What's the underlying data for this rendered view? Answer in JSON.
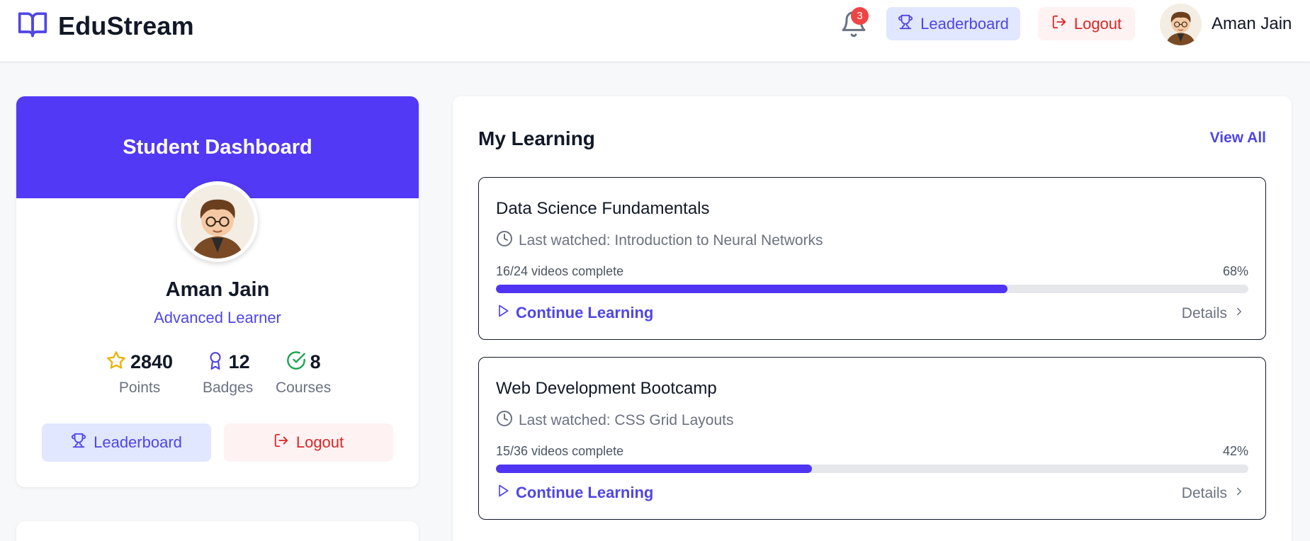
{
  "header": {
    "brand": "EduStream",
    "notification_count": "3",
    "leaderboard_label": "Leaderboard",
    "logout_label": "Logout",
    "user_name": "Aman Jain"
  },
  "profile": {
    "heading": "Student Dashboard",
    "name": "Aman Jain",
    "level": "Advanced Learner",
    "stats": [
      {
        "value": "2840",
        "label": "Points",
        "icon": "star-icon"
      },
      {
        "value": "12",
        "label": "Badges",
        "icon": "award-icon"
      },
      {
        "value": "8",
        "label": "Courses",
        "icon": "check-circle-icon"
      }
    ],
    "leaderboard_label": "Leaderboard",
    "logout_label": "Logout"
  },
  "learning": {
    "title": "My Learning",
    "view_all": "View All",
    "courses": [
      {
        "title": "Data Science Fundamentals",
        "last_watched": "Last watched: Introduction to Neural Networks",
        "progress_text": "16/24 videos complete",
        "percent_label": "68%",
        "progress": 0.68,
        "continue_label": "Continue Learning",
        "details_label": "Details"
      },
      {
        "title": "Web Development Bootcamp",
        "last_watched": "Last watched: CSS Grid Layouts",
        "progress_text": "15/36 videos complete",
        "percent_label": "42%",
        "progress": 0.42,
        "continue_label": "Continue Learning",
        "details_label": "Details"
      }
    ]
  },
  "colors": {
    "accent": "#4f46e5",
    "band": "#5239f6",
    "danger": "#dc2626",
    "badge": "#ef4444"
  }
}
